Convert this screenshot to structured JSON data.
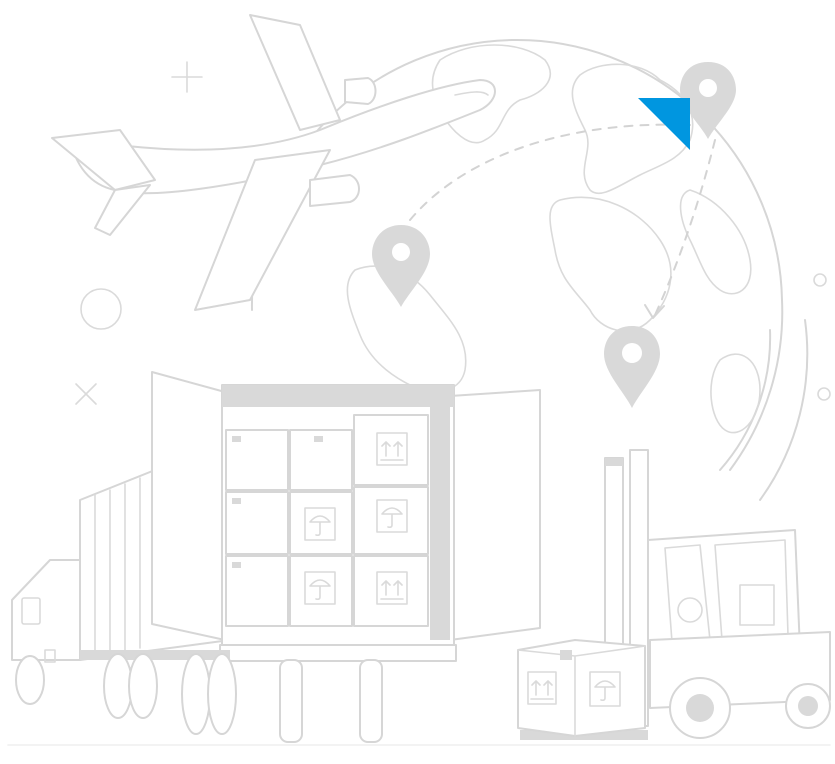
{
  "illustration": {
    "subject": "global-logistics-illustration",
    "colors": {
      "line": "#d6d6d6",
      "fill_gray": "#d9d9d9",
      "accent": "#0096e0",
      "background": "#ffffff"
    },
    "icons": [
      "globe-icon",
      "airplane-icon",
      "location-pin-icon",
      "shipping-container-truck-icon",
      "forklift-icon",
      "cargo-box-icon",
      "this-side-up-icon",
      "keep-dry-umbrella-icon"
    ]
  }
}
